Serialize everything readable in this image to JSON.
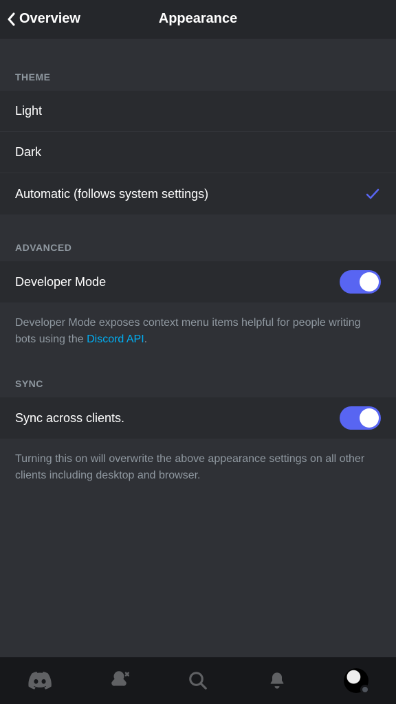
{
  "header": {
    "back": "Overview",
    "title": "Appearance"
  },
  "theme": {
    "label": "THEME",
    "options": [
      {
        "label": "Light",
        "selected": false
      },
      {
        "label": "Dark",
        "selected": false
      },
      {
        "label": "Automatic (follows system settings)",
        "selected": true
      }
    ]
  },
  "advanced": {
    "label": "ADVANCED",
    "dev_mode": {
      "label": "Developer Mode",
      "on": true
    },
    "footer_pre": "Developer Mode exposes context menu items helpful for people writing bots using the ",
    "footer_link": "Discord API",
    "footer_post": "."
  },
  "sync": {
    "label": "SYNC",
    "across": {
      "label": "Sync across clients.",
      "on": true
    },
    "footer": "Turning this on will overwrite the above appearance settings on all other clients including desktop and browser."
  },
  "colors": {
    "accent": "#5865f2",
    "link": "#00aff4"
  }
}
